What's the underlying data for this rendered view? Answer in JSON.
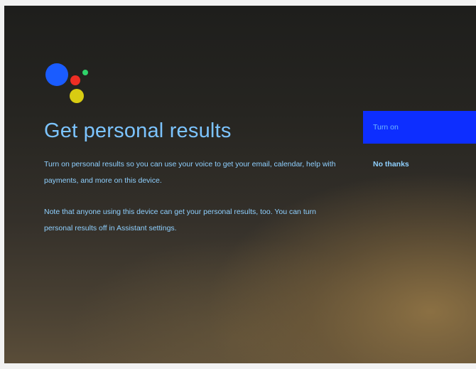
{
  "screen": {
    "title": "Get personal results",
    "description_1": "Turn on personal results so you can use your voice to get your email, calendar, help with payments, and more on this device.",
    "description_2": "Note that anyone using this device can get your personal results, too. You can turn personal results off in Assistant settings."
  },
  "actions": {
    "turn_on_label": "Turn on",
    "no_thanks_label": "No thanks"
  },
  "logo": {
    "icon": "google-assistant-icon",
    "colors": {
      "blue": "#1a5cff",
      "red": "#ee2e24",
      "green": "#2fd36a",
      "yellow": "#d8cc12"
    }
  },
  "colors": {
    "accent": "#0d2eff",
    "text": "#8fd0ff"
  }
}
